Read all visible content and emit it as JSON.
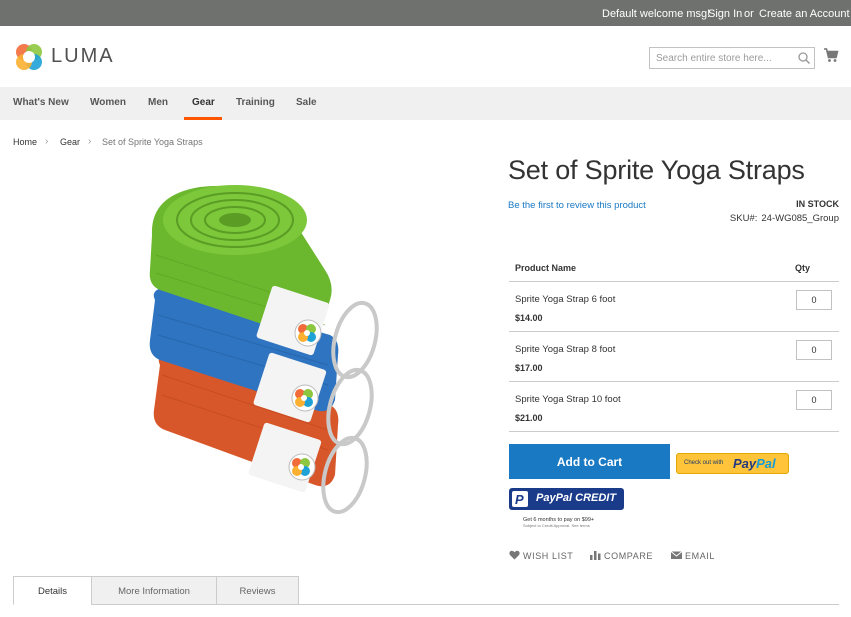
{
  "topbar": {
    "welcome": "Default welcome msg!",
    "signin": "Sign In",
    "or": "or",
    "create_account": "Create an Account"
  },
  "header": {
    "logo_text": "LUMA",
    "search_placeholder": "Search entire store here..."
  },
  "nav": {
    "items": [
      {
        "label": "What's New"
      },
      {
        "label": "Women"
      },
      {
        "label": "Men"
      },
      {
        "label": "Gear"
      },
      {
        "label": "Training"
      },
      {
        "label": "Sale"
      }
    ],
    "active": "Gear",
    "accent": "#ff5501"
  },
  "breadcrumb": {
    "home": "Home",
    "gear": "Gear",
    "current": "Set of Sprite Yoga Straps",
    "separator": "›"
  },
  "product": {
    "title": "Set of Sprite Yoga Straps",
    "review_link": "Be the first to review this product",
    "stock": "IN STOCK",
    "sku_label": "SKU#:",
    "sku": "24-WG085_Group",
    "table": {
      "col_name": "Product Name",
      "col_qty": "Qty",
      "rows": [
        {
          "name": "Sprite Yoga Strap 6 foot",
          "price": "$14.00",
          "qty": "0"
        },
        {
          "name": "Sprite Yoga Strap 8 foot",
          "price": "$17.00",
          "qty": "0"
        },
        {
          "name": "Sprite Yoga Strap 10 foot",
          "price": "$21.00",
          "qty": "0"
        }
      ]
    },
    "add_to_cart": "Add to Cart",
    "paypal": {
      "checkout_small": "Check out with",
      "brand_1": "Pay",
      "brand_2": "Pal",
      "credit_label": "PayPal CREDIT",
      "terms": "Get 6 months to pay on $99+",
      "terms_small": "Subject to Credit Approval. See terms"
    },
    "actions": {
      "wishlist": "WISH LIST",
      "compare": "COMPARE",
      "email": "EMAIL"
    }
  },
  "tabs": [
    {
      "label": "Details"
    },
    {
      "label": "More Information"
    },
    {
      "label": "Reviews"
    }
  ],
  "colors": {
    "primary_blue": "#1979c3",
    "topbar": "#6e716e",
    "strap_green": "#6bb82e",
    "strap_blue": "#2f74c0",
    "strap_orange": "#d8572a"
  }
}
